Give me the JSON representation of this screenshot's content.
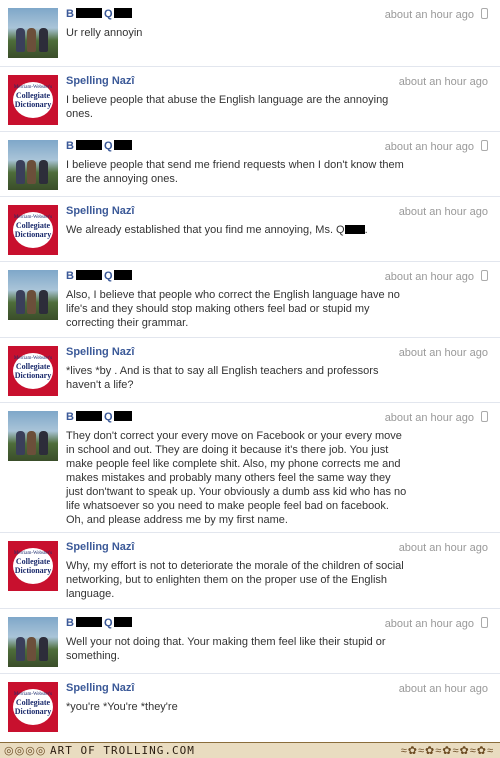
{
  "messages": [
    {
      "sender": "Spelling Nazî",
      "sender_prefix": "B",
      "sender_mid": "Q",
      "kind": "user",
      "time": "about an hour ago",
      "mobile": true,
      "text": "Ur relly annoyin"
    },
    {
      "sender": "Spelling Nazî",
      "kind": "nazi",
      "time": "about an hour ago",
      "mobile": false,
      "text": "I believe people that abuse the English language are the annoying ones."
    },
    {
      "sender_prefix": "B",
      "sender_mid": "Q",
      "kind": "user",
      "time": "about an hour ago",
      "mobile": true,
      "text": "I believe people that send me friend requests when I don't know them are the annoying ones."
    },
    {
      "sender": "Spelling Nazî",
      "kind": "nazi",
      "time": "about an hour ago",
      "mobile": false,
      "text": "We already established that you find me annoying, Ms. Q"
    },
    {
      "sender_prefix": "B",
      "sender_mid": "Q",
      "kind": "user",
      "time": "about an hour ago",
      "mobile": true,
      "text": "Also, I believe that people who correct the English language have no life's and they should stop making others feel bad or stupid my correcting their grammar."
    },
    {
      "sender": "Spelling Nazî",
      "kind": "nazi",
      "time": "about an hour ago",
      "mobile": false,
      "text": "*lives *by . And is that to say all English teachers and professors haven't a life?"
    },
    {
      "sender_prefix": "B",
      "sender_mid": "Q",
      "kind": "user",
      "time": "about an hour ago",
      "mobile": true,
      "text": "They don't correct your every move on Facebook or your every move in school and out. They are doing it because it's there job. You just make people feel like complete shit. Also, my phone corrects me and makes mistakes and probably many others feel the same way they just don'twant to speak up. Your obviously a dumb ass kid who has no life whatsoever so you need to make people feel bad on facebook. Oh, and please address me by my first name."
    },
    {
      "sender": "Spelling Nazî",
      "kind": "nazi",
      "time": "about an hour ago",
      "mobile": false,
      "text": "Why, my effort is not to deteriorate the morale of the children of social networking, but to enlighten them on the proper use of the English language."
    },
    {
      "sender_prefix": "B",
      "sender_mid": "Q",
      "kind": "user",
      "time": "about an hour ago",
      "mobile": true,
      "text": "Well your not doing that. Your making them feel like their stupid or something."
    },
    {
      "sender": "Spelling Nazî",
      "kind": "nazi",
      "time": "about an hour ago",
      "mobile": false,
      "text": "*you're *You're *they're"
    }
  ],
  "dictionary_logo": {
    "line1": "Merriam-Webster's",
    "line2": "Collegiate",
    "line3": "Dictionary"
  },
  "footer": {
    "title": "ART OF TROLLING.COM",
    "deco_left": "◎◎◎◎",
    "deco_right": "≈✿≈✿≈✿≈✿≈✿≈"
  },
  "colors": {
    "link": "#3b5998",
    "time": "#999999",
    "dictionary_red": "#c8102e"
  }
}
